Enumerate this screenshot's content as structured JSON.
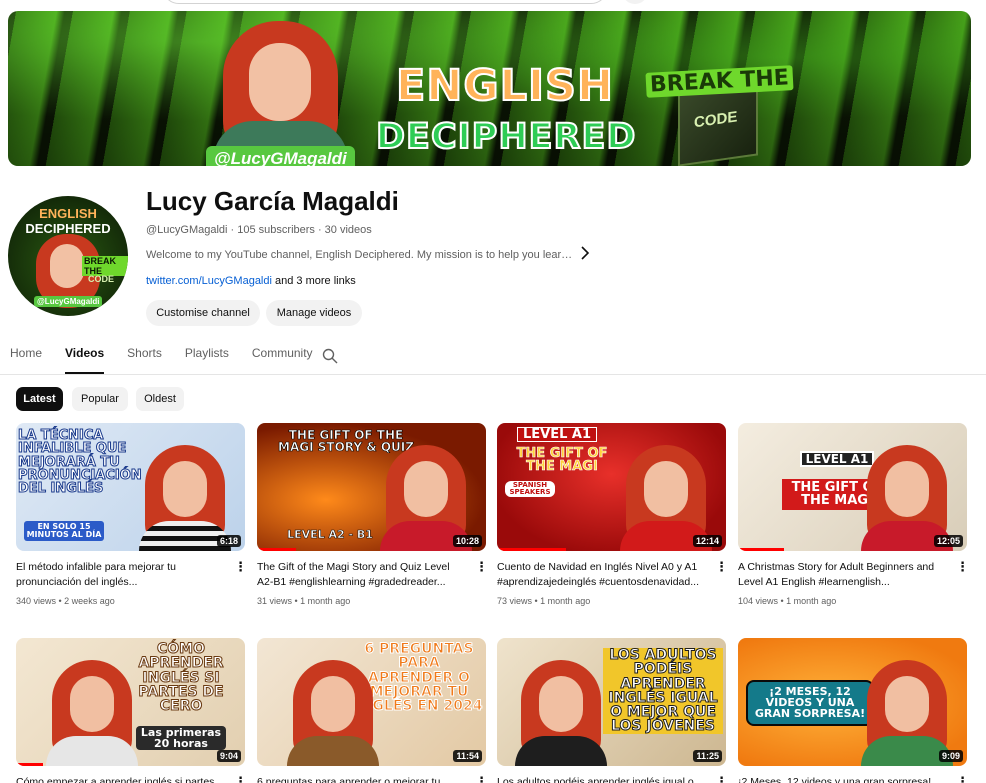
{
  "banner": {
    "title_line1": "ENGLISH",
    "title_line2": "DECIPHERED",
    "break_text": "BREAK THE",
    "code_text": "CODE",
    "handle": "@LucyGMagaldi"
  },
  "avatar": {
    "line1": "ENGLISH",
    "line2": "DECIPHERED",
    "break_text": "BREAK THE",
    "code_text": "CODE",
    "handle": "@LucyGMagaldi"
  },
  "channel": {
    "name": "Lucy García Magaldi",
    "meta": "@LucyGMagaldi · 105 subscribers · 30 videos",
    "description": "Welcome to my YouTube channel, English Deciphered. My mission is to help you learn or i...",
    "link_text": "twitter.com/LucyGMagaldi",
    "more_links": " and 3 more links",
    "customise_label": "Customise channel",
    "manage_label": "Manage videos"
  },
  "tabs": [
    "Home",
    "Videos",
    "Shorts",
    "Playlists",
    "Community"
  ],
  "active_tab": "Videos",
  "chips": [
    "Latest",
    "Popular",
    "Oldest"
  ],
  "videos": [
    {
      "thumb_text": "LA TÉCNICA INFALIBLE QUE MEJORARÁ TU PRONUNCIACIÓN DEL INGLÉS",
      "thumb_subtext": "EN SOLO 15 MINUTOS AL DÍA",
      "duration": "6:18",
      "watched_fraction": 0.0,
      "title": "El método infalible para mejorar tu pronunciación del inglés...",
      "meta": "340 views • 2 weeks ago"
    },
    {
      "thumb_text": "THE GIFT OF THE MAGI STORY & QUIZ",
      "thumb_subtext": "LEVEL A2 - B1",
      "duration": "10:28",
      "watched_fraction": 0.17,
      "title": "The Gift of the Magi Story and Quiz Level A2-B1 #englishlearning #gradedreader...",
      "meta": "31 views • 1 month ago"
    },
    {
      "thumb_text": "LEVEL A1",
      "thumb_subtext": "THE GIFT OF THE MAGI",
      "thumb_badge": "SPANISH SPEAKERS",
      "duration": "12:14",
      "watched_fraction": 0.3,
      "title": "Cuento de Navidad en Inglés Nivel A0 y A1 #aprendizajedeinglés #cuentosdenavidad...",
      "meta": "73 views • 1 month ago"
    },
    {
      "thumb_text": "LEVEL A1",
      "thumb_subtext": "THE GIFT OF THE MAGI",
      "duration": "12:05",
      "watched_fraction": 0.2,
      "title": "A Christmas Story for Adult Beginners and Level A1 English #learnenglish...",
      "meta": "104 views • 1 month ago"
    },
    {
      "thumb_text": "CÓMO APRENDER INGLÉS SI PARTES DE CERO",
      "thumb_subtext": "Las primeras 20 horas",
      "duration": "9:04",
      "watched_fraction": 0.12,
      "title": "Cómo empezar a aprender inglés si partes...",
      "meta": ""
    },
    {
      "thumb_text": "6 PREGUNTAS PARA APRENDER O MEJORAR TU INGLÉS EN 2024",
      "thumb_subtext": "",
      "duration": "11:54",
      "watched_fraction": 0.0,
      "title": "6 preguntas para aprender o mejorar tu...",
      "meta": ""
    },
    {
      "thumb_text": "LOS ADULTOS PODÉIS APRENDER INGLÉS IGUAL O MEJOR QUE LOS JÓVENES",
      "thumb_subtext": "",
      "duration": "11:25",
      "watched_fraction": 0.0,
      "title": "Los adultos podéis aprender inglés igual o...",
      "meta": ""
    },
    {
      "thumb_text": "¡2 MESES, 12 VIDEOS Y UNA GRAN SORPRESA!",
      "thumb_subtext": "",
      "duration": "9:09",
      "watched_fraction": 0.0,
      "title": "¡2 Meses, 12 videos y una gran sorpresa!...",
      "meta": ""
    }
  ],
  "colors": {
    "accent_red": "#ff0000",
    "link_blue": "#065fd4",
    "text_primary": "#0f0f0f",
    "text_secondary": "#606060",
    "chip_bg": "#f2f2f2"
  },
  "icons": {
    "search": "search-icon",
    "more": "more-vert-icon",
    "chevron": "chevron-right-icon"
  }
}
